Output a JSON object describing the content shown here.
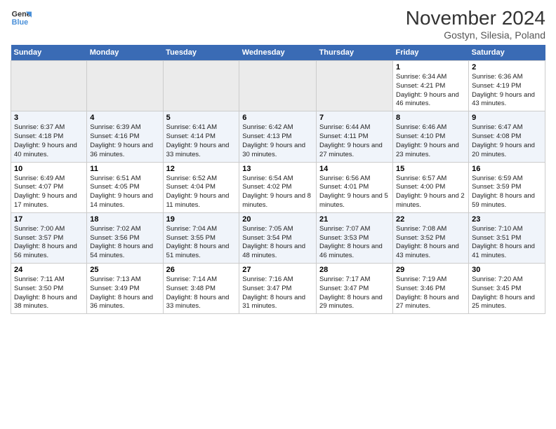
{
  "logo": {
    "line1": "General",
    "line2": "Blue"
  },
  "title": "November 2024",
  "subtitle": "Gostyn, Silesia, Poland",
  "days_of_week": [
    "Sunday",
    "Monday",
    "Tuesday",
    "Wednesday",
    "Thursday",
    "Friday",
    "Saturday"
  ],
  "weeks": [
    [
      {
        "day": "",
        "info": ""
      },
      {
        "day": "",
        "info": ""
      },
      {
        "day": "",
        "info": ""
      },
      {
        "day": "",
        "info": ""
      },
      {
        "day": "",
        "info": ""
      },
      {
        "day": "1",
        "info": "Sunrise: 6:34 AM\nSunset: 4:21 PM\nDaylight: 9 hours\nand 46 minutes."
      },
      {
        "day": "2",
        "info": "Sunrise: 6:36 AM\nSunset: 4:19 PM\nDaylight: 9 hours\nand 43 minutes."
      }
    ],
    [
      {
        "day": "3",
        "info": "Sunrise: 6:37 AM\nSunset: 4:18 PM\nDaylight: 9 hours\nand 40 minutes."
      },
      {
        "day": "4",
        "info": "Sunrise: 6:39 AM\nSunset: 4:16 PM\nDaylight: 9 hours\nand 36 minutes."
      },
      {
        "day": "5",
        "info": "Sunrise: 6:41 AM\nSunset: 4:14 PM\nDaylight: 9 hours\nand 33 minutes."
      },
      {
        "day": "6",
        "info": "Sunrise: 6:42 AM\nSunset: 4:13 PM\nDaylight: 9 hours\nand 30 minutes."
      },
      {
        "day": "7",
        "info": "Sunrise: 6:44 AM\nSunset: 4:11 PM\nDaylight: 9 hours\nand 27 minutes."
      },
      {
        "day": "8",
        "info": "Sunrise: 6:46 AM\nSunset: 4:10 PM\nDaylight: 9 hours\nand 23 minutes."
      },
      {
        "day": "9",
        "info": "Sunrise: 6:47 AM\nSunset: 4:08 PM\nDaylight: 9 hours\nand 20 minutes."
      }
    ],
    [
      {
        "day": "10",
        "info": "Sunrise: 6:49 AM\nSunset: 4:07 PM\nDaylight: 9 hours\nand 17 minutes."
      },
      {
        "day": "11",
        "info": "Sunrise: 6:51 AM\nSunset: 4:05 PM\nDaylight: 9 hours\nand 14 minutes."
      },
      {
        "day": "12",
        "info": "Sunrise: 6:52 AM\nSunset: 4:04 PM\nDaylight: 9 hours\nand 11 minutes."
      },
      {
        "day": "13",
        "info": "Sunrise: 6:54 AM\nSunset: 4:02 PM\nDaylight: 9 hours\nand 8 minutes."
      },
      {
        "day": "14",
        "info": "Sunrise: 6:56 AM\nSunset: 4:01 PM\nDaylight: 9 hours\nand 5 minutes."
      },
      {
        "day": "15",
        "info": "Sunrise: 6:57 AM\nSunset: 4:00 PM\nDaylight: 9 hours\nand 2 minutes."
      },
      {
        "day": "16",
        "info": "Sunrise: 6:59 AM\nSunset: 3:59 PM\nDaylight: 8 hours\nand 59 minutes."
      }
    ],
    [
      {
        "day": "17",
        "info": "Sunrise: 7:00 AM\nSunset: 3:57 PM\nDaylight: 8 hours\nand 56 minutes."
      },
      {
        "day": "18",
        "info": "Sunrise: 7:02 AM\nSunset: 3:56 PM\nDaylight: 8 hours\nand 54 minutes."
      },
      {
        "day": "19",
        "info": "Sunrise: 7:04 AM\nSunset: 3:55 PM\nDaylight: 8 hours\nand 51 minutes."
      },
      {
        "day": "20",
        "info": "Sunrise: 7:05 AM\nSunset: 3:54 PM\nDaylight: 8 hours\nand 48 minutes."
      },
      {
        "day": "21",
        "info": "Sunrise: 7:07 AM\nSunset: 3:53 PM\nDaylight: 8 hours\nand 46 minutes."
      },
      {
        "day": "22",
        "info": "Sunrise: 7:08 AM\nSunset: 3:52 PM\nDaylight: 8 hours\nand 43 minutes."
      },
      {
        "day": "23",
        "info": "Sunrise: 7:10 AM\nSunset: 3:51 PM\nDaylight: 8 hours\nand 41 minutes."
      }
    ],
    [
      {
        "day": "24",
        "info": "Sunrise: 7:11 AM\nSunset: 3:50 PM\nDaylight: 8 hours\nand 38 minutes."
      },
      {
        "day": "25",
        "info": "Sunrise: 7:13 AM\nSunset: 3:49 PM\nDaylight: 8 hours\nand 36 minutes."
      },
      {
        "day": "26",
        "info": "Sunrise: 7:14 AM\nSunset: 3:48 PM\nDaylight: 8 hours\nand 33 minutes."
      },
      {
        "day": "27",
        "info": "Sunrise: 7:16 AM\nSunset: 3:47 PM\nDaylight: 8 hours\nand 31 minutes."
      },
      {
        "day": "28",
        "info": "Sunrise: 7:17 AM\nSunset: 3:47 PM\nDaylight: 8 hours\nand 29 minutes."
      },
      {
        "day": "29",
        "info": "Sunrise: 7:19 AM\nSunset: 3:46 PM\nDaylight: 8 hours\nand 27 minutes."
      },
      {
        "day": "30",
        "info": "Sunrise: 7:20 AM\nSunset: 3:45 PM\nDaylight: 8 hours\nand 25 minutes."
      }
    ]
  ]
}
